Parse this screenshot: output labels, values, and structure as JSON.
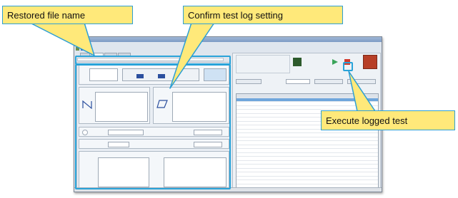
{
  "annotations": {
    "restored_file_name": "Restored file name",
    "confirm_test_log": "Confirm test log setting",
    "execute_logged_test": "Execute logged test"
  },
  "colors": {
    "callout_fill": "#ffe97a",
    "callout_border": "#2d9fd4",
    "highlight": "#29a3d9",
    "run_button": "#3aa45a",
    "stop_button": "#d33a2c",
    "selected_row": "#6fa6dc"
  },
  "icons": [
    "play-icon",
    "stop-icon",
    "warning-icon",
    "device-icon"
  ]
}
